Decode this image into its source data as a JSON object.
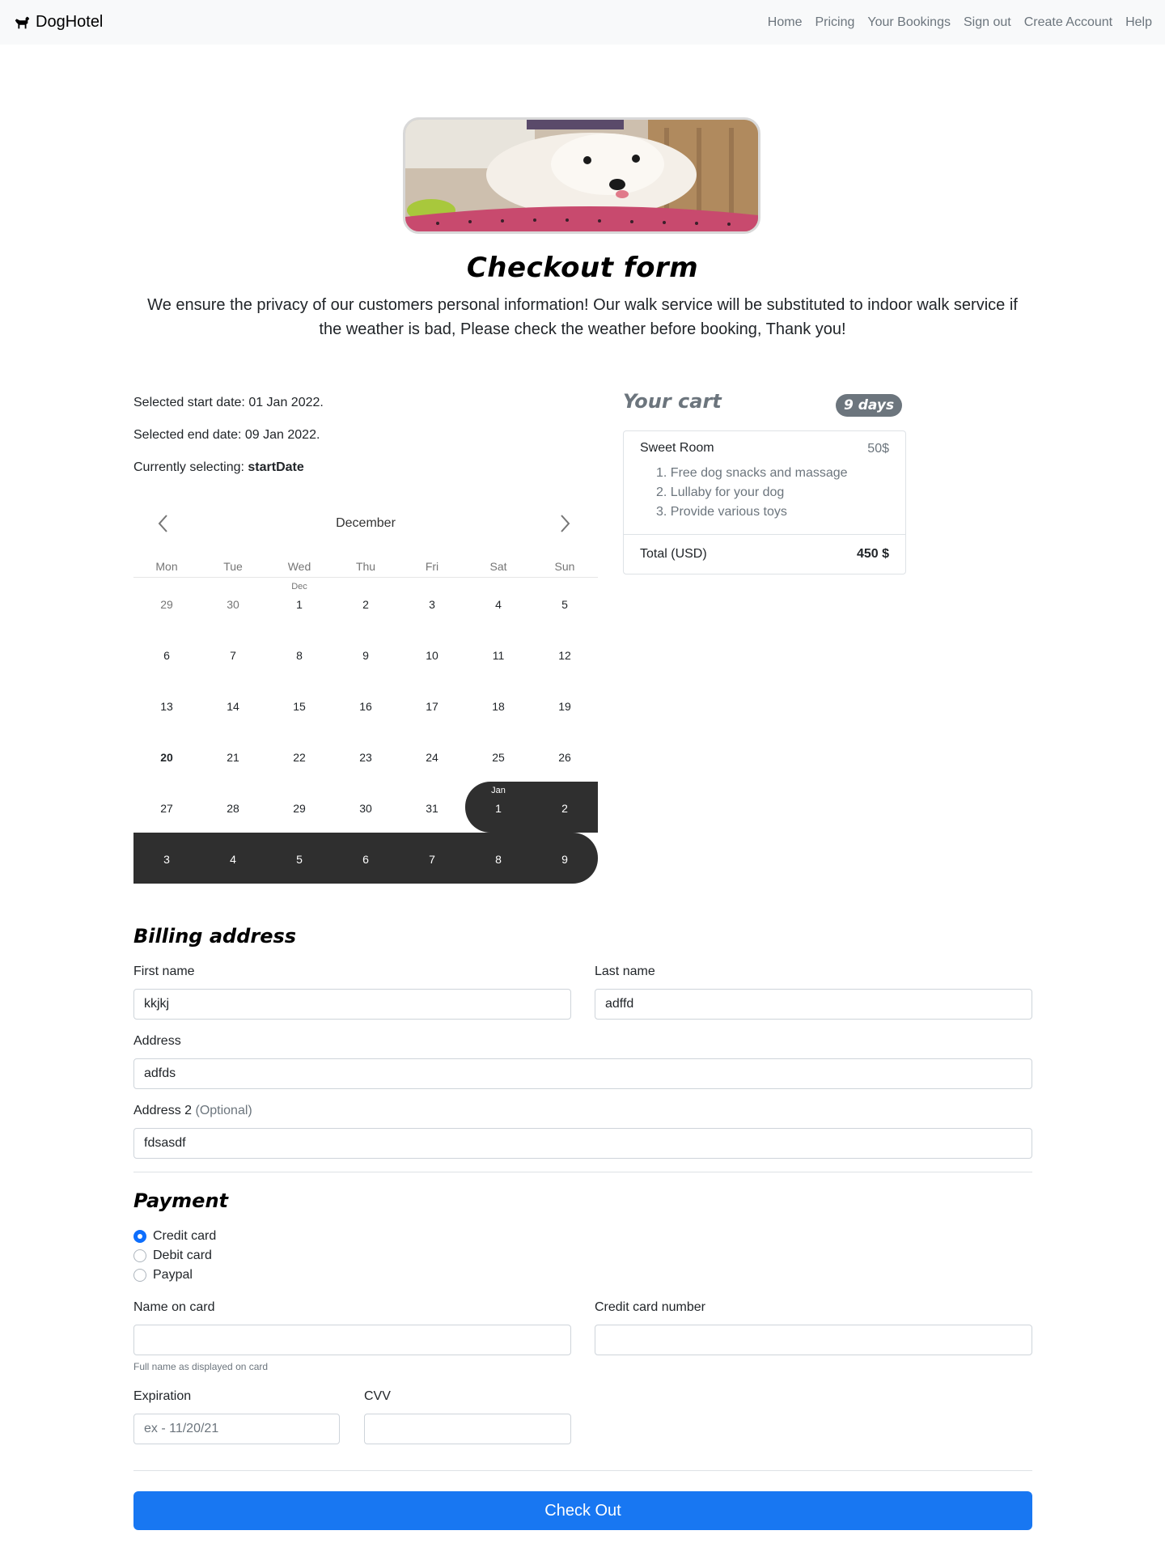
{
  "navbar": {
    "brand": "DogHotel",
    "links": [
      "Home",
      "Pricing",
      "Your Bookings",
      "Sign out",
      "Create Account",
      "Help"
    ]
  },
  "hero": {
    "title": "Checkout form",
    "lead": "We ensure the privacy of our customers personal information! Our walk service will be substituted to indoor walk service if the weather is bad, Please check the weather before booking, Thank you!"
  },
  "dates": {
    "start_prefix": "Selected start date: ",
    "start_value": "01 Jan 2022.",
    "end_prefix": "Selected end date: ",
    "end_value": "09 Jan 2022.",
    "selecting_prefix": "Currently selecting: ",
    "selecting_value": "startDate"
  },
  "calendar": {
    "month": "December",
    "weekdays": [
      "Mon",
      "Tue",
      "Wed",
      "Thu",
      "Fri",
      "Sat",
      "Sun"
    ],
    "days": [
      {
        "n": "29",
        "muted": true
      },
      {
        "n": "30",
        "muted": true
      },
      {
        "n": "1",
        "label": "Dec"
      },
      {
        "n": "2"
      },
      {
        "n": "3"
      },
      {
        "n": "4"
      },
      {
        "n": "5"
      },
      {
        "n": "6"
      },
      {
        "n": "7"
      },
      {
        "n": "8"
      },
      {
        "n": "9"
      },
      {
        "n": "10"
      },
      {
        "n": "11"
      },
      {
        "n": "12"
      },
      {
        "n": "13"
      },
      {
        "n": "14"
      },
      {
        "n": "15"
      },
      {
        "n": "16"
      },
      {
        "n": "17"
      },
      {
        "n": "18"
      },
      {
        "n": "19"
      },
      {
        "n": "20",
        "bold": true
      },
      {
        "n": "21"
      },
      {
        "n": "22"
      },
      {
        "n": "23"
      },
      {
        "n": "24"
      },
      {
        "n": "25"
      },
      {
        "n": "26"
      },
      {
        "n": "27"
      },
      {
        "n": "28"
      },
      {
        "n": "29"
      },
      {
        "n": "30"
      },
      {
        "n": "31"
      },
      {
        "n": "1",
        "label": "Jan",
        "sel": "start"
      },
      {
        "n": "2",
        "sel": "mid"
      },
      {
        "n": "3",
        "sel": "mid"
      },
      {
        "n": "4",
        "sel": "mid"
      },
      {
        "n": "5",
        "sel": "mid"
      },
      {
        "n": "6",
        "sel": "mid"
      },
      {
        "n": "7",
        "sel": "mid"
      },
      {
        "n": "8",
        "sel": "mid"
      },
      {
        "n": "9",
        "sel": "end"
      }
    ]
  },
  "cart": {
    "title": "Your cart",
    "badge": "9 days",
    "item_name": "Sweet Room",
    "item_price": "50$",
    "features": [
      "1. Free dog snacks and massage",
      "2. Lullaby for your dog",
      "3. Provide various toys"
    ],
    "total_label": "Total (USD)",
    "total_value": "450 $"
  },
  "billing": {
    "heading": "Billing address",
    "first_name_label": "First name",
    "first_name_value": "kkjkj",
    "last_name_label": "Last name",
    "last_name_value": "adffd",
    "address_label": "Address",
    "address_value": "adfds",
    "address2_label": "Address 2 ",
    "address2_optional": "(Optional)",
    "address2_value": "fdsasdf"
  },
  "payment": {
    "heading": "Payment",
    "methods": [
      "Credit card",
      "Debit card",
      "Paypal"
    ],
    "selected_method": "Credit card",
    "name_label": "Name on card",
    "name_value": "",
    "name_help": "Full name as displayed on card",
    "cc_label": "Credit card number",
    "cc_value": "",
    "exp_label": "Expiration",
    "exp_placeholder": "ex - 11/20/21",
    "cvv_label": "CVV",
    "cvv_value": ""
  },
  "checkout_button": "Check Out",
  "colors": {
    "primary": "#1877f2",
    "selected_range": "#2f2f2f",
    "muted": "#6c757d",
    "navbar_bg": "#f8f9fa"
  }
}
